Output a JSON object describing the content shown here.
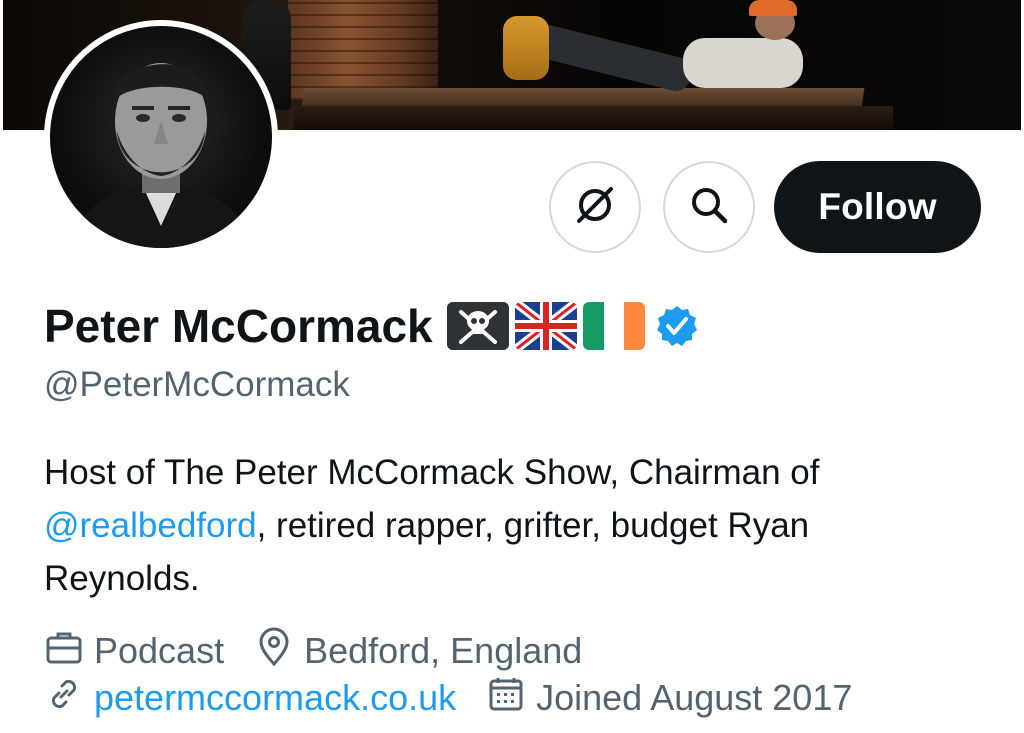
{
  "profile": {
    "display_name": "Peter McCormack",
    "handle": "@PeterMcCormack",
    "name_emojis": [
      "pirate-flag",
      "uk-flag",
      "ireland-flag"
    ],
    "verified": true
  },
  "actions": {
    "follow_label": "Follow"
  },
  "bio": {
    "part1": "Host of The Peter McCormack Show, Chairman of ",
    "mention": "@realbedford",
    "part2": ", retired rapper, grifter, budget Ryan Reynolds."
  },
  "meta": {
    "category": "Podcast",
    "location": "Bedford, England",
    "website": "petermccormack.co.uk",
    "joined": "Joined August 2017"
  },
  "colors": {
    "accent": "#1d9bf0",
    "text_primary": "#0f1419",
    "text_secondary": "#536471",
    "follow_bg": "#0f1419",
    "border": "#cfd9de"
  },
  "icons": {
    "grok": "grok-icon",
    "search": "search-icon",
    "verified": "verified-badge-icon",
    "category": "briefcase-icon",
    "location": "location-pin-icon",
    "website": "link-icon",
    "joined": "calendar-icon"
  }
}
